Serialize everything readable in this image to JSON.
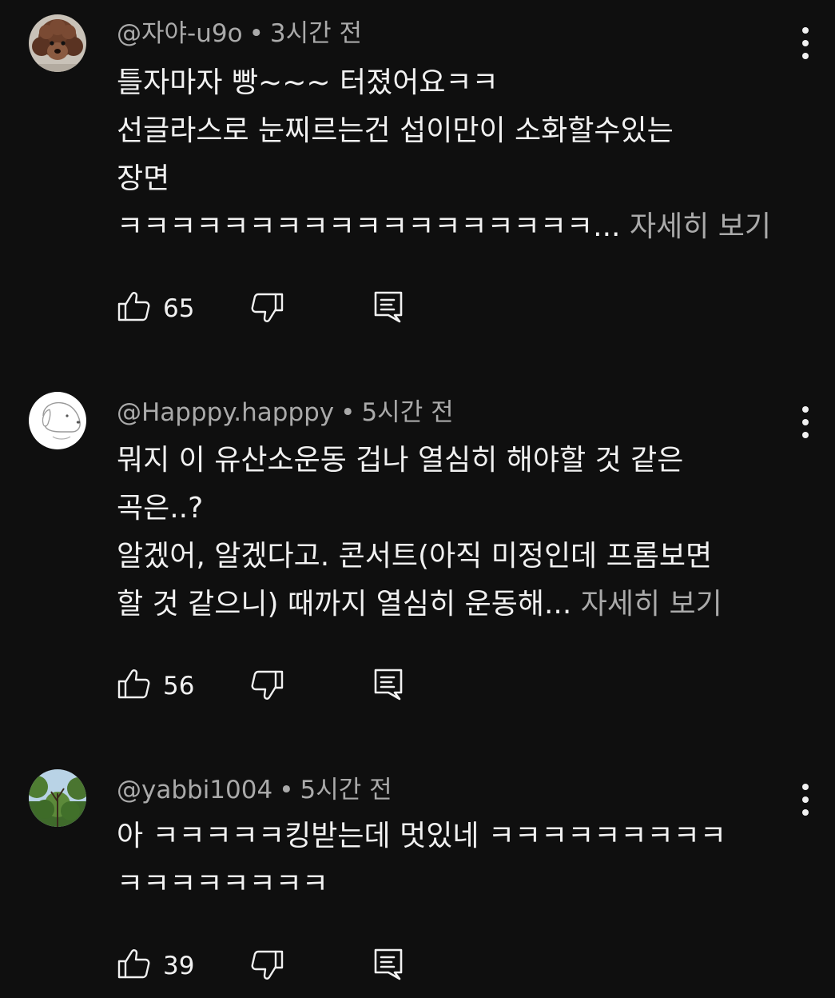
{
  "comments": [
    {
      "handle": "@자야-u9o",
      "separator": "•",
      "time": "3시간 전",
      "lines": [
        "틀자마자 빵~~~ 터졌어요ㅋㅋ",
        "선글라스로 눈찌르는건 섭이만이 소화할수있는",
        "장면",
        "ㅋㅋㅋㅋㅋㅋㅋㅋㅋㅋㅋㅋㅋㅋㅋㅋㅋㅋ..."
      ],
      "more_label": "자세히 보기",
      "likes": "65",
      "avatar_icon": "poodle-avatar-icon"
    },
    {
      "handle": "@Happpy.happpy",
      "separator": "•",
      "time": "5시간 전",
      "lines": [
        "뭐지 이 유산소운동 겁나 열심히 해야할 것 같은",
        "곡은..?",
        "알겠어, 알겠다고. 콘서트(아직 미정인데 프롬보면",
        "할 것 같으니) 때까지 열심히 운동해..."
      ],
      "more_label": "자세히 보기",
      "likes": "56",
      "avatar_icon": "dog-sketch-avatar-icon"
    },
    {
      "handle": "@yabbi1004",
      "separator": "•",
      "time": "5시간 전",
      "lines": [
        "아 ㅋㅋㅋㅋㅋ킹받는데 멋있네 ㅋㅋㅋㅋㅋㅋㅋㅋㅋ",
        "ㅋㅋㅋㅋㅋㅋㅋㅋ"
      ],
      "more_label": "",
      "likes": "39",
      "avatar_icon": "trees-avatar-icon"
    }
  ],
  "icons": {
    "like": "thumbs-up-icon",
    "dislike": "thumbs-down-icon",
    "reply": "reply-icon",
    "menu": "more-vert-icon"
  },
  "colors": {
    "background": "#0f0f0f",
    "primary_text": "#f1f1f1",
    "secondary_text": "#aaaaaa"
  }
}
